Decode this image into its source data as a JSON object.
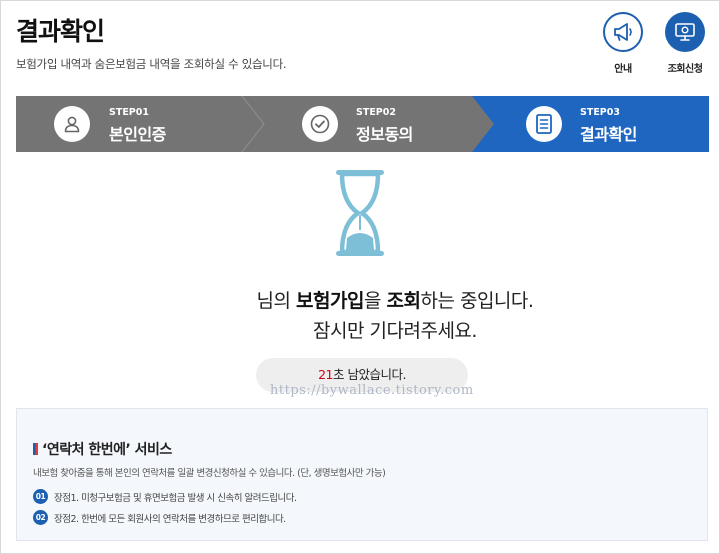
{
  "header": {
    "title": "결과확인",
    "description": "보험가입 내역과 숨은보험금 내역을 조회하실 수 있습니다."
  },
  "top_buttons": [
    {
      "label": "안내",
      "icon": "megaphone-icon"
    },
    {
      "label": "조회신청",
      "icon": "monitor-icon"
    }
  ],
  "steps": [
    {
      "number": "STEP01",
      "name": "본인인증",
      "icon": "user-icon",
      "active": false
    },
    {
      "number": "STEP02",
      "name": "정보동의",
      "icon": "check-icon",
      "active": false
    },
    {
      "number": "STEP03",
      "name": "결과확인",
      "icon": "document-icon",
      "active": true
    }
  ],
  "status": {
    "line1": {
      "suffix_name": "님의 ",
      "keyword1": "보험가입",
      "mid": "을 ",
      "keyword2": "조회",
      "end": "하는 중입니다."
    },
    "line2": "잠시만 기다려주세요.",
    "timer_seconds": "21",
    "timer_suffix": "초 남았습니다.",
    "watermark": "https://bywallace.tistory.com"
  },
  "service": {
    "title": "‘연락처 한번에’ 서비스",
    "description": "내보험 찾아줌을 통해 본인의 연락처를 일괄 변경신청하실 수 있습니다. (단, 생명보험사만 가능)",
    "items": [
      {
        "num": "01",
        "text": "장점1. 미청구보험금 및 휴면보험금 발생 시 신속히 알려드립니다."
      },
      {
        "num": "02",
        "text": "장점2. 한번에 모든 회원사의 연락처를 변경하므로 편리합니다."
      }
    ]
  },
  "colors": {
    "accent": "#1f66c1",
    "step_inactive": "#747474",
    "timer_highlight": "#d0021b",
    "hourglass": "#7ebfd8"
  }
}
